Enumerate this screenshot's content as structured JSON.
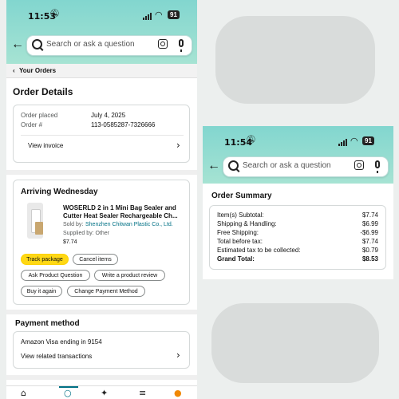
{
  "phone1": {
    "status": {
      "time": "11:53",
      "battery": "91"
    },
    "search": {
      "placeholder": "Search or ask a question"
    },
    "breadcrumb": "Your Orders",
    "order_details": {
      "title": "Order Details",
      "order_placed_label": "Order placed",
      "order_placed_value": "July 4, 2025",
      "order_number_label": "Order #",
      "order_number_value": "113-0585287-7326666",
      "view_invoice": "View invoice"
    },
    "shipment": {
      "status": "Arriving Wednesday",
      "product_title_line1": "WOSERLD 2 in 1 Mini Bag Sealer and",
      "product_title_line2": "Cutter Heat Sealer Rechargeable Ch...",
      "sold_by_label": "Sold by:",
      "sold_by_value": "Shenzhen Chitwan Plastic Co., Ltd.",
      "supplied_by": "Supplied by: Other",
      "price": "$7.74",
      "buttons": {
        "track": "Track package",
        "cancel": "Cancel items",
        "ask": "Ask Product Question",
        "review": "Write a product review",
        "buy_again": "Buy it again",
        "change_payment": "Change Payment Method"
      }
    },
    "payment": {
      "title": "Payment method",
      "card_line": "Amazon Visa  ending in 9154",
      "view_transactions": "View related transactions"
    }
  },
  "phone2": {
    "status": {
      "time": "11:54",
      "battery": "91"
    },
    "search": {
      "placeholder": "Search or ask a question"
    },
    "order_summary": {
      "title": "Order Summary",
      "rows": [
        {
          "label": "Item(s) Subtotal:",
          "value": "$7.74"
        },
        {
          "label": "Shipping & Handling:",
          "value": "$6.99"
        },
        {
          "label": "Free Shipping:",
          "value": "-$6.99"
        },
        {
          "label": "Total before tax:",
          "value": "$7.74"
        },
        {
          "label": "Estimated tax to be collected:",
          "value": "$0.79"
        },
        {
          "label": "Grand Total:",
          "value": "$8.53"
        }
      ]
    }
  },
  "colors": {
    "header": "#82d6cf",
    "accent_yellow": "#ffd814",
    "link": "#007185"
  }
}
